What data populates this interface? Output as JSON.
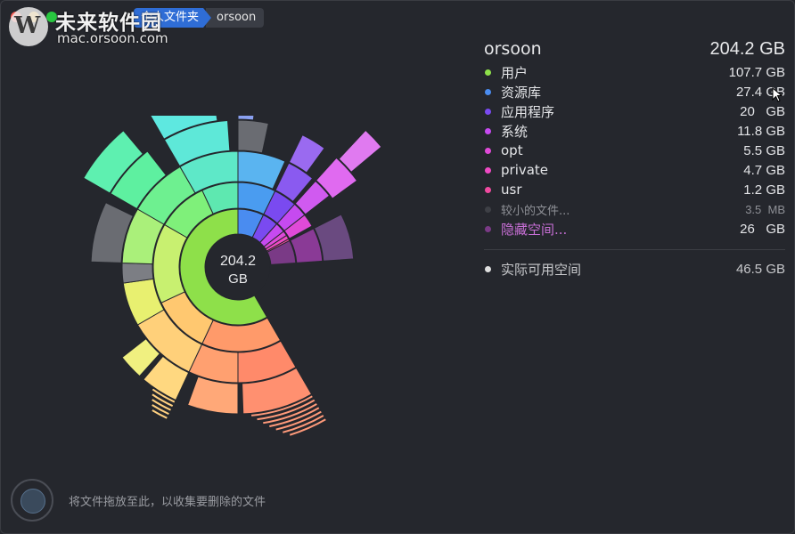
{
  "watermark": {
    "title": "未来软件园",
    "url": "mac.orsoon.com",
    "logo_letter": "W"
  },
  "breadcrumb": {
    "home_label": "个人文件夹",
    "current_label": "orsoon"
  },
  "sunburst": {
    "center_value": "204.2",
    "center_unit": "GB"
  },
  "panel": {
    "title": "orsoon",
    "total": "204.2 GB",
    "items": [
      {
        "name": "用户",
        "value": "107.7 GB",
        "color": "#8ee04a"
      },
      {
        "name": "资源库",
        "value": "27.4 GB",
        "color": "#4a8cf0"
      },
      {
        "name": "应用程序",
        "value": "20   GB",
        "color": "#7a4af0"
      },
      {
        "name": "系统",
        "value": "11.8 GB",
        "color": "#c64af0"
      },
      {
        "name": "opt",
        "value": "5.5 GB",
        "color": "#e04ad8"
      },
      {
        "name": "private",
        "value": "4.7 GB",
        "color": "#f04ac4"
      },
      {
        "name": "usr",
        "value": "1.2 GB",
        "color": "#f04aa0"
      },
      {
        "name": "较小的文件...",
        "value": "3.5  MB",
        "color": "#3e4046"
      },
      {
        "name": "隐藏空间...",
        "value": "26   GB",
        "color": "#7a3a86"
      }
    ],
    "free": {
      "name": "实际可用空间",
      "value": "46.5 GB",
      "color": "#e0e0e0"
    }
  },
  "dropzone": {
    "hint": "将文件拖放至此，以收集要删除的文件"
  }
}
